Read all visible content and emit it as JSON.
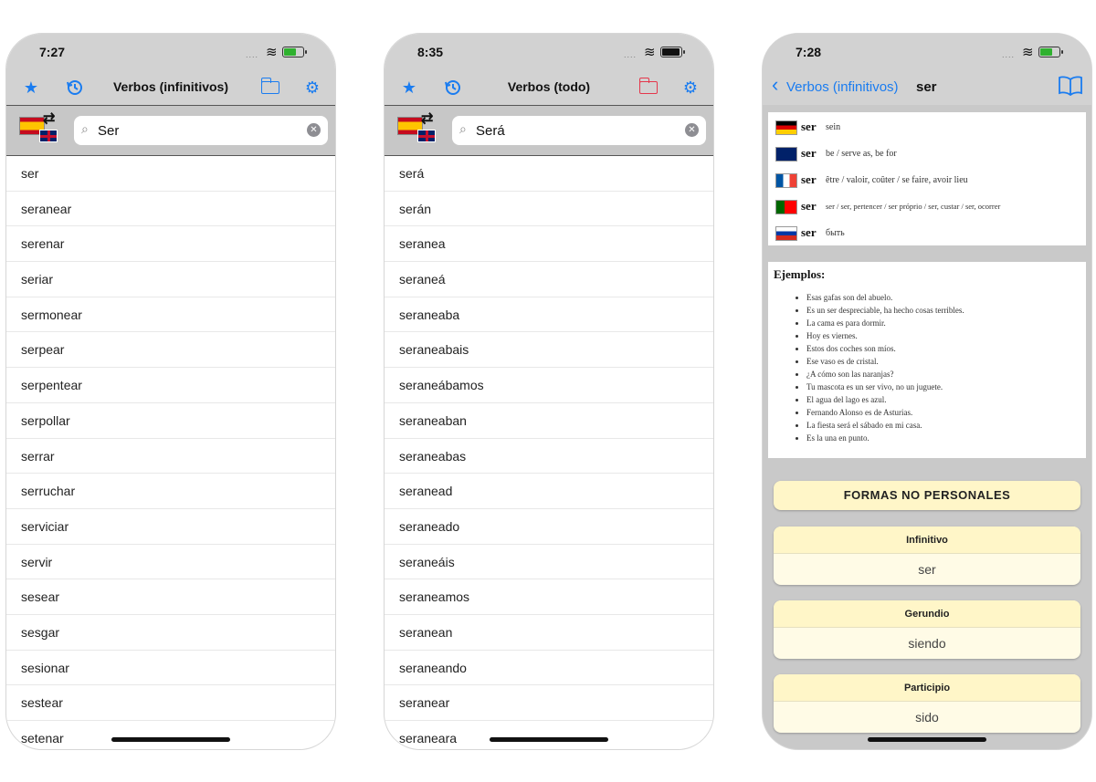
{
  "phone1": {
    "time": "7:27",
    "title": "Verbos (infinitivos)",
    "search_value": "Ser",
    "items": [
      "ser",
      "seranear",
      "serenar",
      "seriar",
      "sermonear",
      "serpear",
      "serpentear",
      "serpollar",
      "serrar",
      "serruchar",
      "serviciar",
      "servir",
      "sesear",
      "sesgar",
      "sesionar",
      "sestear",
      "setenar"
    ]
  },
  "phone2": {
    "time": "8:35",
    "title": "Verbos (todo)",
    "search_value": "Será",
    "items": [
      "será",
      "serán",
      "seranea",
      "seraneá",
      "seraneaba",
      "seraneabais",
      "seraneábamos",
      "seraneaban",
      "seraneabas",
      "seranead",
      "seraneado",
      "seraneáis",
      "seraneamos",
      "seranean",
      "seraneando",
      "seranear",
      "seraneara"
    ]
  },
  "phone3": {
    "time": "7:28",
    "back_label": "Verbos (infinitivos)",
    "title": "ser",
    "translations": [
      {
        "word": "ser",
        "desc": "sein"
      },
      {
        "word": "ser",
        "desc": "be / serve as, be for"
      },
      {
        "word": "ser",
        "desc": "être / valoir, coûter / se faire, avoir lieu"
      },
      {
        "word": "ser",
        "desc": "ser / ser, pertencer / ser próprio / ser, custar / ser, ocorrer"
      },
      {
        "word": "ser",
        "desc": "быть"
      }
    ],
    "examples_title": "Ejemplos:",
    "examples": [
      "Esas gafas son del abuelo.",
      "Es un ser despreciable, ha hecho cosas terribles.",
      "La cama es para dormir.",
      "Hoy es viernes.",
      "Estos dos coches son míos.",
      "Ese vaso es de cristal.",
      "¿A cómo son las naranjas?",
      "Tu mascota es un ser vivo, no un juguete.",
      "El agua del lago es azul.",
      "Fernando Alonso es de Asturias.",
      "La fiesta será el sábado en mi casa.",
      "Es la una en punto."
    ],
    "forms_header": "FORMAS NO PERSONALES",
    "infinitivo_label": "Infinitivo",
    "infinitivo_value": "ser",
    "gerundio_label": "Gerundio",
    "gerundio_value": "siendo",
    "participio_label": "Participio",
    "participio_value": "sido"
  },
  "colors": {
    "accent": "#1a7cf0",
    "bar": "#d2d2d2",
    "card": "#fff6c8"
  },
  "icons": [
    "star-icon",
    "history-icon",
    "folder-icon",
    "gear-icon",
    "search-icon",
    "clear-icon",
    "back-chevron-icon",
    "book-icon"
  ]
}
